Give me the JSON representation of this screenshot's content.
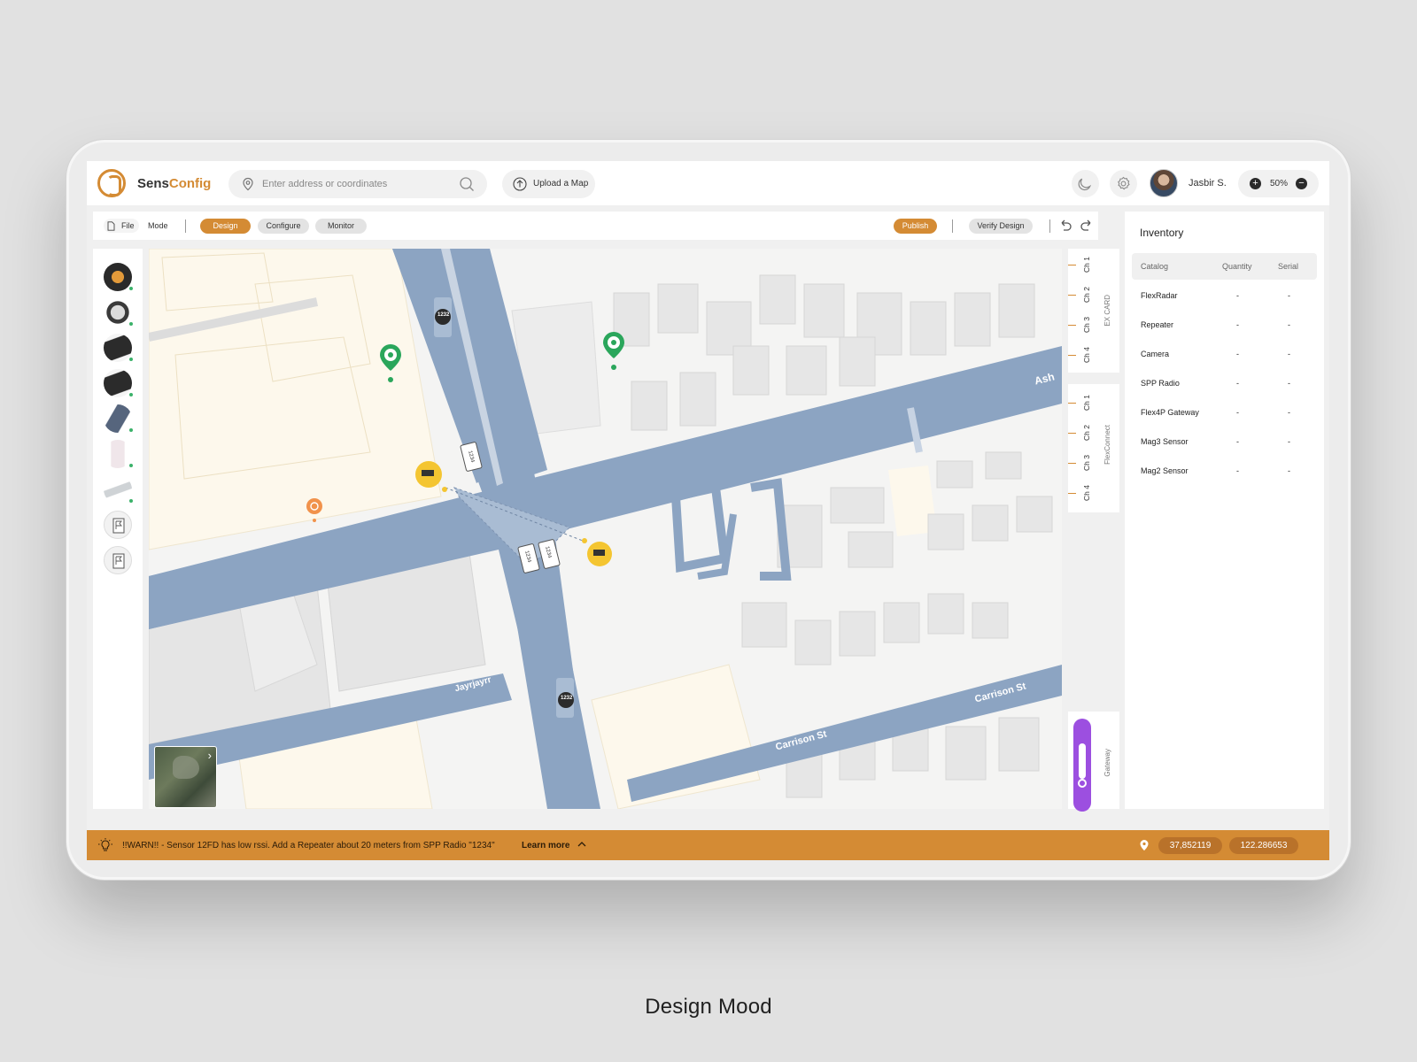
{
  "caption": "Design Mood",
  "app": {
    "name_part1": "Sens",
    "name_part2": "Config",
    "accent": "#d48b34"
  },
  "search": {
    "placeholder": "Enter address or coordinates"
  },
  "upload": {
    "label": "Upload a Map"
  },
  "user": {
    "name": "Jasbir S."
  },
  "zoom": {
    "value": "50%"
  },
  "toolbar": {
    "file_label": "File",
    "mode_label": "Mode",
    "modes": [
      "Design",
      "Configure",
      "Monitor"
    ],
    "active_mode": "Design",
    "publish_label": "Publish",
    "verify_label": "Verify Design"
  },
  "palette": {
    "items": [
      "flexradar-device",
      "mag3-sensor",
      "flex4p-gateway",
      "flex4p-gateway-alt",
      "repeater",
      "spp-radio",
      "camera",
      "flag-marker",
      "flag-marker"
    ]
  },
  "map": {
    "street_labels": [
      "Ash",
      "Carrison St",
      "Carrison St",
      "Jayrjayrr"
    ],
    "sensor_labels": [
      "1232",
      "1232",
      "1234",
      "1234",
      "1234"
    ]
  },
  "channels": {
    "ex_card": {
      "title": "EX CARD",
      "channels": [
        "Ch 1",
        "Ch 2",
        "Ch 3",
        "Ch 4"
      ]
    },
    "flexconnect": {
      "title": "FlexConnect",
      "channels": [
        "Ch 1",
        "Ch 2",
        "Ch 3",
        "Ch 4"
      ]
    },
    "gateway": {
      "title": "Gateway",
      "color": "#9c4fe0"
    }
  },
  "inventory": {
    "title": "Inventory",
    "columns": [
      "Catalog",
      "Quantity",
      "Serial"
    ],
    "rows": [
      {
        "catalog": "FlexRadar",
        "quantity": "-",
        "serial": "-"
      },
      {
        "catalog": "Repeater",
        "quantity": "-",
        "serial": "-"
      },
      {
        "catalog": "Camera",
        "quantity": "-",
        "serial": "-"
      },
      {
        "catalog": "SPP Radio",
        "quantity": "-",
        "serial": "-"
      },
      {
        "catalog": "Flex4P Gateway",
        "quantity": "-",
        "serial": "-"
      },
      {
        "catalog": "Mag3 Sensor",
        "quantity": "-",
        "serial": "-"
      },
      {
        "catalog": "Mag2 Sensor",
        "quantity": "-",
        "serial": "-"
      }
    ]
  },
  "status": {
    "warning": "!!WARN!! - Sensor 12FD has low rssi. Add a Repeater about 20 meters from SPP Radio \"1234\"",
    "learn_more": "Learn more",
    "latitude": "37,852119",
    "longitude": "122.286653"
  }
}
